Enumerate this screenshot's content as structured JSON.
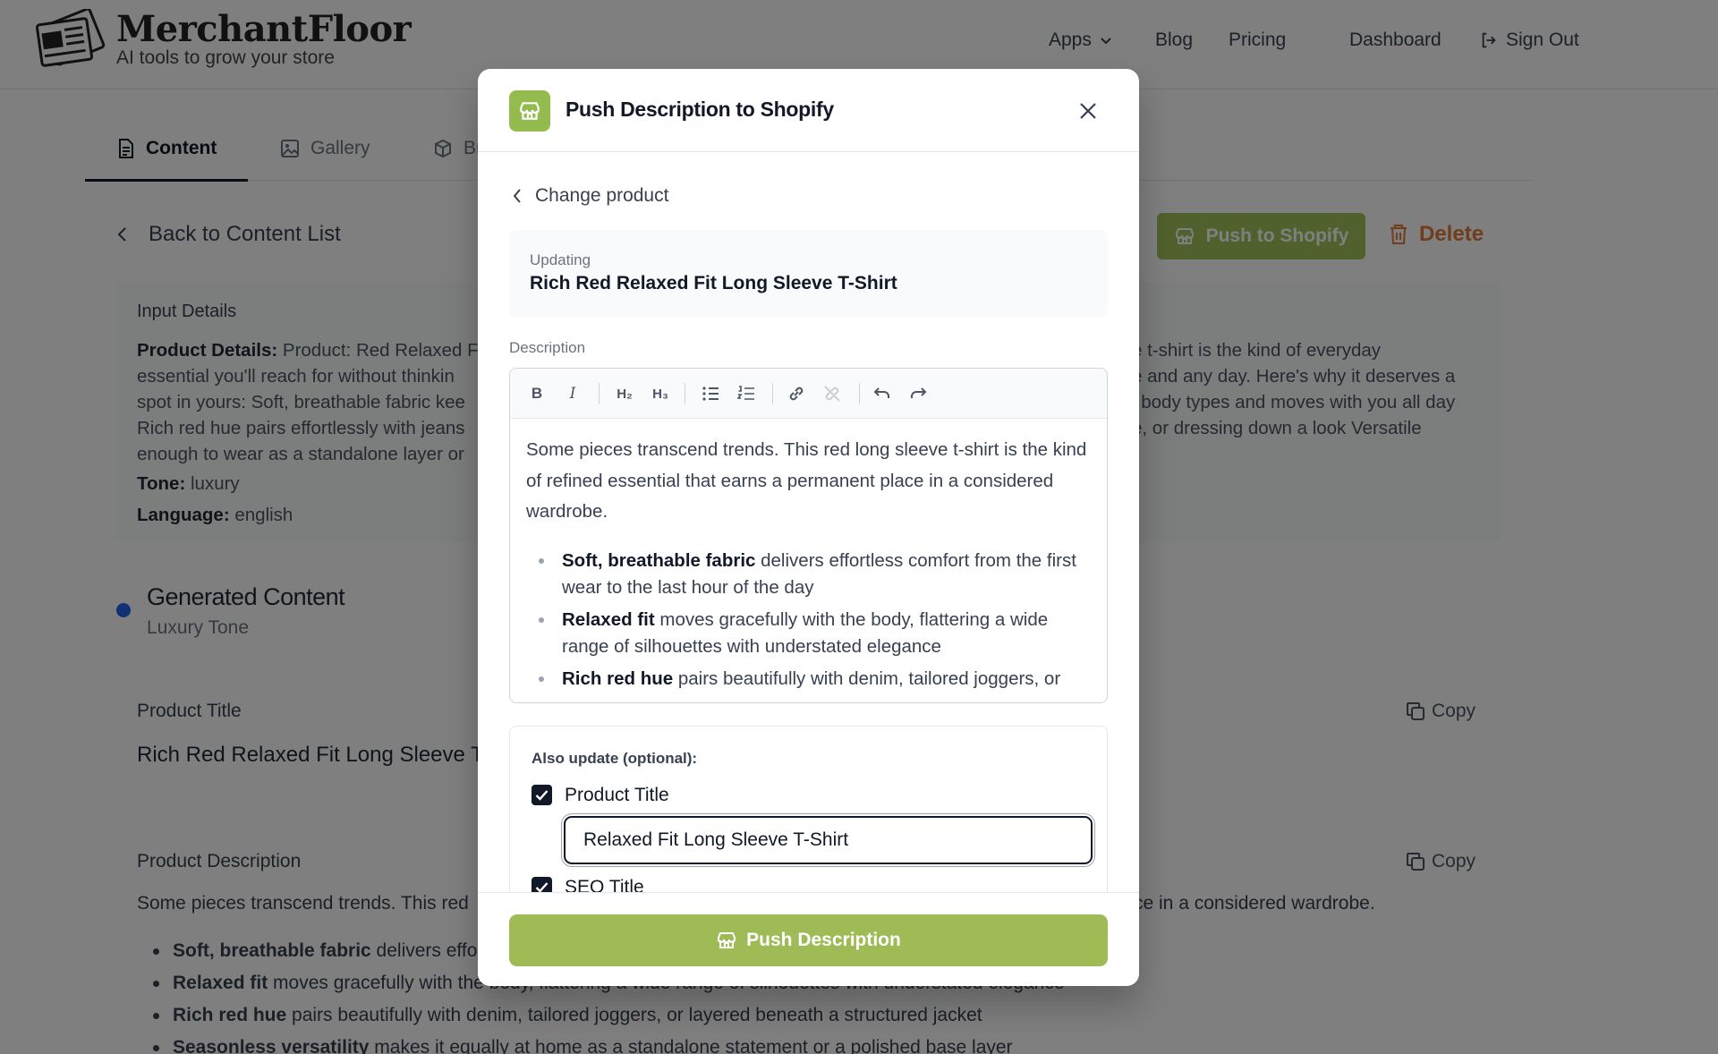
{
  "brand": {
    "name": "MerchantFloor",
    "tagline": "AI tools to grow your store"
  },
  "nav": {
    "apps": "Apps",
    "blog": "Blog",
    "pricing": "Pricing",
    "dashboard": "Dashboard",
    "sign_out": "Sign Out"
  },
  "tabs": {
    "content": "Content",
    "gallery": "Gallery",
    "third_partial": "Br"
  },
  "actions": {
    "back": "Back to Content List",
    "push": "Push to Shopify",
    "delete": "Delete"
  },
  "input_details": {
    "heading": "Input Details",
    "product_label": "Product Details:",
    "product_left_lines": [
      "Product: Red Relaxed F",
      "essential you'll reach for without thinkin",
      "spot in yours: Soft, breathable fabric kee",
      "Rich red hue pairs effortlessly with jeans",
      "enough to wear as a standalone layer or"
    ],
    "product_right_lines": [
      "e t-shirt is the kind of everyday",
      "e and any day. Here's why it deserves a",
      "l body types and moves with you all day",
      "e, or dressing down a look Versatile",
      ""
    ],
    "tone_label": "Tone:",
    "tone": "luxury",
    "language_label": "Language:",
    "language": "english"
  },
  "generated": {
    "title": "Generated Content",
    "subtitle": "Luxury Tone",
    "product_title_label": "Product Title",
    "product_title_value": "Rich Red Relaxed Fit Long Sleeve T",
    "copy": "Copy",
    "product_description_label": "Product Description",
    "desc_para_left": "Some pieces transcend trends. This red",
    "desc_para_right": "ce in a considered wardrobe.",
    "bullets": [
      {
        "bold": "Soft, breathable fabric",
        "text": " delivers effo",
        "tail": ""
      },
      {
        "bold": "Relaxed fit",
        "text": " moves gracefully with th",
        "tail": "e body, flattering a wide range of silhouettes with understated elegance"
      },
      {
        "bold": "Rich red hue",
        "text": " pairs beautifully with denim, tailored joggers, or layered beneath a structured jacket",
        "tail": ""
      },
      {
        "bold": "Seasonless versatility",
        "text": " makes it equally at home as a standalone statement or a polished base layer",
        "tail": ""
      }
    ]
  },
  "modal": {
    "title": "Push Description to Shopify",
    "change_product": "Change product",
    "updating_label": "Updating",
    "updating_product": "Rich Red Relaxed Fit Long Sleeve T-Shirt",
    "description_label": "Description",
    "toolbar": {
      "bold": "B",
      "italic": "I",
      "h2": "H₂",
      "h3": "H₃"
    },
    "editor_paragraph": "Some pieces transcend trends. This red long sleeve t-shirt is the kind of refined essential that earns a permanent place in a considered wardrobe.",
    "editor_bullets": [
      {
        "bold": "Soft, breathable fabric",
        "text": " delivers effortless comfort from the first wear to the last hour of the day"
      },
      {
        "bold": "Relaxed fit",
        "text": " moves gracefully with the body, flattering a wide range of silhouettes with understated elegance"
      },
      {
        "bold": "Rich red hue",
        "text": " pairs beautifully with denim, tailored joggers, or"
      }
    ],
    "also_update_label": "Also update (optional):",
    "product_title_option": "Product Title",
    "product_title_input": "Relaxed Fit Long Sleeve T-Shirt",
    "seo_title_option": "SEO Title",
    "push_button": "Push Description"
  },
  "colors": {
    "accent_green": "#9ebb55",
    "icon_green": "#94bb4e",
    "delete_orange": "#e07a3a",
    "generated_dot": "#2563eb"
  }
}
